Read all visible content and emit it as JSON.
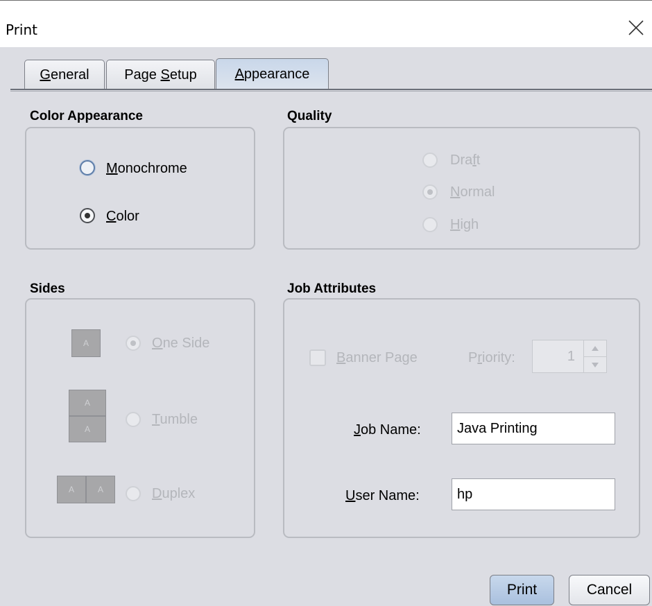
{
  "window": {
    "title": "Print"
  },
  "tabs": [
    {
      "label": "General",
      "mnemonic": "G",
      "rest": "eneral"
    },
    {
      "label": "Page Setup",
      "pre": "Page ",
      "mnemonic": "S",
      "rest": "etup"
    },
    {
      "label": "Appearance",
      "mnemonic": "A",
      "rest": "ppearance",
      "active": true
    }
  ],
  "color_appearance": {
    "title": "Color Appearance",
    "options": [
      {
        "mnemonic": "M",
        "rest": "onochrome",
        "selected": false
      },
      {
        "mnemonic": "C",
        "rest": "olor",
        "selected": true
      }
    ]
  },
  "quality": {
    "title": "Quality",
    "options": [
      {
        "pre": "Dra",
        "mnemonic": "f",
        "rest": "t",
        "selected": false
      },
      {
        "pre": "",
        "mnemonic": "N",
        "rest": "ormal",
        "selected": true
      },
      {
        "pre": "",
        "mnemonic": "H",
        "rest": "igh",
        "selected": false
      }
    ]
  },
  "sides": {
    "title": "Sides",
    "page_letter": "A",
    "options": [
      {
        "mnemonic": "O",
        "rest": "ne Side",
        "selected": true
      },
      {
        "mnemonic": "T",
        "rest": "umble",
        "selected": false
      },
      {
        "mnemonic": "D",
        "rest": "uplex",
        "selected": false
      }
    ]
  },
  "job_attributes": {
    "title": "Job Attributes",
    "banner_page": {
      "mnemonic": "B",
      "rest": "anner Page",
      "checked": false
    },
    "priority": {
      "pre": "P",
      "mnemonic": "r",
      "rest": "iority:",
      "value": "1"
    },
    "job_name": {
      "mnemonic": "J",
      "rest": "ob Name:",
      "value": "Java Printing"
    },
    "user_name": {
      "mnemonic": "U",
      "rest": "ser Name:",
      "value": "hp"
    }
  },
  "buttons": {
    "print": "Print",
    "cancel": "Cancel"
  }
}
